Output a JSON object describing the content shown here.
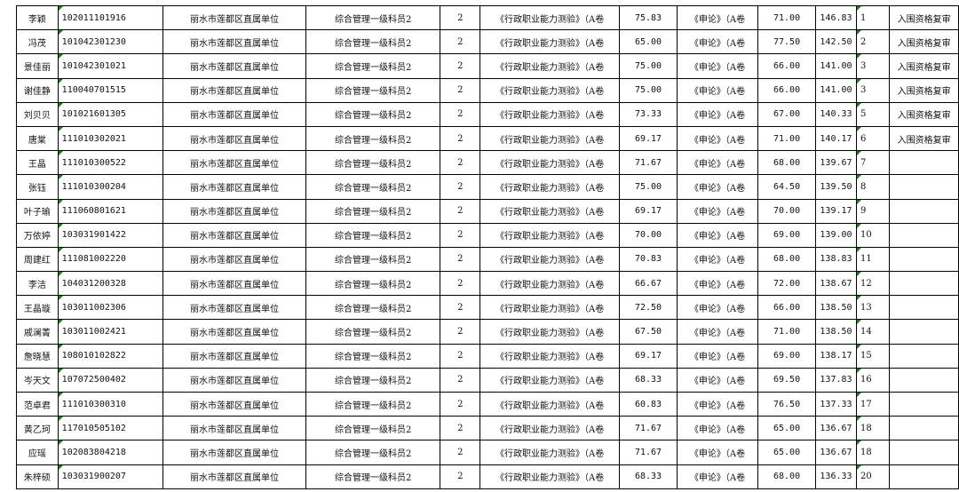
{
  "rows": [
    {
      "name": "李颖",
      "id": "102011101916",
      "unit": "丽水市莲都区直属单位",
      "position": "综合管理一级科员2",
      "quota": "2",
      "subj1": "《行政职业能力测验》（A卷",
      "score1": "75.83",
      "subj2": "《申论》（A卷",
      "score2": "71.00",
      "total": "146.83",
      "rank": "1",
      "note": "入围资格复审"
    },
    {
      "name": "冯茂",
      "id": "101042301230",
      "unit": "丽水市莲都区直属单位",
      "position": "综合管理一级科员2",
      "quota": "2",
      "subj1": "《行政职业能力测验》（A卷",
      "score1": "65.00",
      "subj2": "《申论》（A卷",
      "score2": "77.50",
      "total": "142.50",
      "rank": "2",
      "note": "入围资格复审"
    },
    {
      "name": "景佳丽",
      "id": "101042301021",
      "unit": "丽水市莲都区直属单位",
      "position": "综合管理一级科员2",
      "quota": "2",
      "subj1": "《行政职业能力测验》（A卷",
      "score1": "75.00",
      "subj2": "《申论》（A卷",
      "score2": "66.00",
      "total": "141.00",
      "rank": "3",
      "note": "入围资格复审"
    },
    {
      "name": "谢佳静",
      "id": "110040701515",
      "unit": "丽水市莲都区直属单位",
      "position": "综合管理一级科员2",
      "quota": "2",
      "subj1": "《行政职业能力测验》（A卷",
      "score1": "75.00",
      "subj2": "《申论》（A卷",
      "score2": "66.00",
      "total": "141.00",
      "rank": "3",
      "note": "入围资格复审"
    },
    {
      "name": "刘贝贝",
      "id": "101021601305",
      "unit": "丽水市莲都区直属单位",
      "position": "综合管理一级科员2",
      "quota": "2",
      "subj1": "《行政职业能力测验》（A卷",
      "score1": "73.33",
      "subj2": "《申论》（A卷",
      "score2": "67.00",
      "total": "140.33",
      "rank": "5",
      "note": "入围资格复审"
    },
    {
      "name": "唐棠",
      "id": "111010302021",
      "unit": "丽水市莲都区直属单位",
      "position": "综合管理一级科员2",
      "quota": "2",
      "subj1": "《行政职业能力测验》（A卷",
      "score1": "69.17",
      "subj2": "《申论》（A卷",
      "score2": "71.00",
      "total": "140.17",
      "rank": "6",
      "note": "入围资格复审"
    },
    {
      "name": "王晶",
      "id": "111010300522",
      "unit": "丽水市莲都区直属单位",
      "position": "综合管理一级科员2",
      "quota": "2",
      "subj1": "《行政职业能力测验》（A卷",
      "score1": "71.67",
      "subj2": "《申论》（A卷",
      "score2": "68.00",
      "total": "139.67",
      "rank": "7",
      "note": ""
    },
    {
      "name": "张钰",
      "id": "111010300204",
      "unit": "丽水市莲都区直属单位",
      "position": "综合管理一级科员2",
      "quota": "2",
      "subj1": "《行政职业能力测验》（A卷",
      "score1": "75.00",
      "subj2": "《申论》（A卷",
      "score2": "64.50",
      "total": "139.50",
      "rank": "8",
      "note": ""
    },
    {
      "name": "叶子瑜",
      "id": "111060801621",
      "unit": "丽水市莲都区直属单位",
      "position": "综合管理一级科员2",
      "quota": "2",
      "subj1": "《行政职业能力测验》（A卷",
      "score1": "69.17",
      "subj2": "《申论》（A卷",
      "score2": "70.00",
      "total": "139.17",
      "rank": "9",
      "note": ""
    },
    {
      "name": "万依婷",
      "id": "103031901422",
      "unit": "丽水市莲都区直属单位",
      "position": "综合管理一级科员2",
      "quota": "2",
      "subj1": "《行政职业能力测验》（A卷",
      "score1": "70.00",
      "subj2": "《申论》（A卷",
      "score2": "69.00",
      "total": "139.00",
      "rank": "10",
      "note": ""
    },
    {
      "name": "周建红",
      "id": "111081002220",
      "unit": "丽水市莲都区直属单位",
      "position": "综合管理一级科员2",
      "quota": "2",
      "subj1": "《行政职业能力测验》（A卷",
      "score1": "70.83",
      "subj2": "《申论》（A卷",
      "score2": "68.00",
      "total": "138.83",
      "rank": "11",
      "note": ""
    },
    {
      "name": "李洁",
      "id": "104031200328",
      "unit": "丽水市莲都区直属单位",
      "position": "综合管理一级科员2",
      "quota": "2",
      "subj1": "《行政职业能力测验》（A卷",
      "score1": "66.67",
      "subj2": "《申论》（A卷",
      "score2": "72.00",
      "total": "138.67",
      "rank": "12",
      "note": ""
    },
    {
      "name": "王晶璇",
      "id": "103011002306",
      "unit": "丽水市莲都区直属单位",
      "position": "综合管理一级科员2",
      "quota": "2",
      "subj1": "《行政职业能力测验》（A卷",
      "score1": "72.50",
      "subj2": "《申论》（A卷",
      "score2": "66.00",
      "total": "138.50",
      "rank": "13",
      "note": ""
    },
    {
      "name": "戚澜菁",
      "id": "103011002421",
      "unit": "丽水市莲都区直属单位",
      "position": "综合管理一级科员2",
      "quota": "2",
      "subj1": "《行政职业能力测验》（A卷",
      "score1": "67.50",
      "subj2": "《申论》（A卷",
      "score2": "71.00",
      "total": "138.50",
      "rank": "14",
      "note": ""
    },
    {
      "name": "詹晓慧",
      "id": "108010102822",
      "unit": "丽水市莲都区直属单位",
      "position": "综合管理一级科员2",
      "quota": "2",
      "subj1": "《行政职业能力测验》（A卷",
      "score1": "69.17",
      "subj2": "《申论》（A卷",
      "score2": "69.00",
      "total": "138.17",
      "rank": "15",
      "note": ""
    },
    {
      "name": "岑天文",
      "id": "107072500402",
      "unit": "丽水市莲都区直属单位",
      "position": "综合管理一级科员2",
      "quota": "2",
      "subj1": "《行政职业能力测验》（A卷",
      "score1": "68.33",
      "subj2": "《申论》（A卷",
      "score2": "69.50",
      "total": "137.83",
      "rank": "16",
      "note": ""
    },
    {
      "name": "范卓君",
      "id": "111010300310",
      "unit": "丽水市莲都区直属单位",
      "position": "综合管理一级科员2",
      "quota": "2",
      "subj1": "《行政职业能力测验》（A卷",
      "score1": "60.83",
      "subj2": "《申论》（A卷",
      "score2": "76.50",
      "total": "137.33",
      "rank": "17",
      "note": ""
    },
    {
      "name": "黄乙珂",
      "id": "117010505102",
      "unit": "丽水市莲都区直属单位",
      "position": "综合管理一级科员2",
      "quota": "2",
      "subj1": "《行政职业能力测验》（A卷",
      "score1": "71.67",
      "subj2": "《申论》（A卷",
      "score2": "65.00",
      "total": "136.67",
      "rank": "18",
      "note": ""
    },
    {
      "name": "应瑶",
      "id": "102083804218",
      "unit": "丽水市莲都区直属单位",
      "position": "综合管理一级科员2",
      "quota": "2",
      "subj1": "《行政职业能力测验》（A卷",
      "score1": "71.67",
      "subj2": "《申论》（A卷",
      "score2": "65.00",
      "total": "136.67",
      "rank": "18",
      "note": ""
    },
    {
      "name": "朱梓硕",
      "id": "103031900207",
      "unit": "丽水市莲都区直属单位",
      "position": "综合管理一级科员2",
      "quota": "2",
      "subj1": "《行政职业能力测验》（A卷",
      "score1": "68.33",
      "subj2": "《申论》（A卷",
      "score2": "68.00",
      "total": "136.33",
      "rank": "20",
      "note": ""
    }
  ]
}
